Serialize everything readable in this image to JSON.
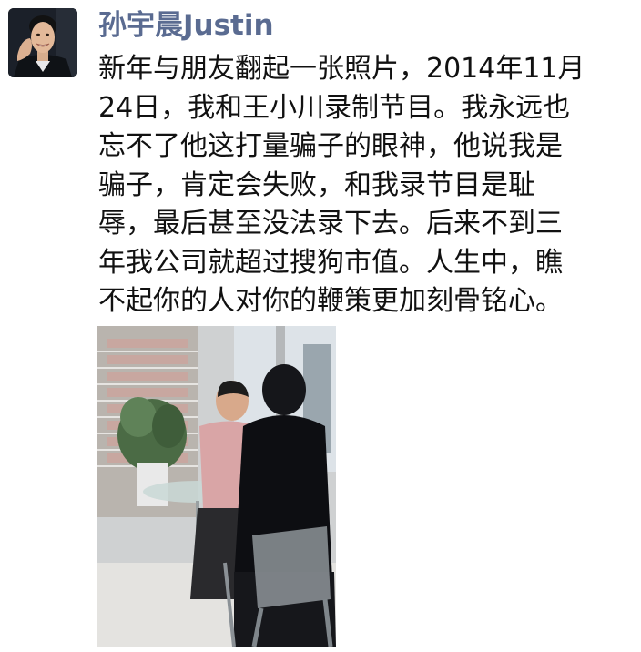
{
  "post": {
    "author_name": "孙宇晨Justin",
    "text_lines": [
      "新年与朋友翻起一张照片，2014年11月",
      "24日，我和王小川录制节目。我永远也",
      "忘不了他这打量骗子的眼神，他说我是",
      "骗子，肯定会失败，和我录节目是耻",
      "辱，最后甚至没法录下去。后来不到三",
      "年我公司就超过搜狗市值。人生中，瞧",
      "不起你的人对你的鞭策更加刻骨铭心。"
    ]
  },
  "colors": {
    "author_name": "#5a6b91",
    "text": "#111111",
    "background": "#ffffff"
  }
}
